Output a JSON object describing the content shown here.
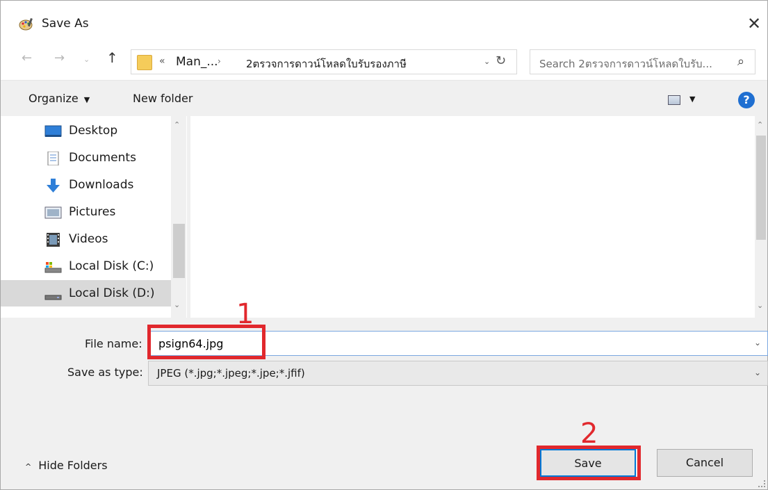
{
  "window": {
    "title": "Save As",
    "close_glyph": "✕",
    "icons": {
      "app": "palette-app-icon",
      "close": "close-icon"
    }
  },
  "nav": {
    "back": "←",
    "forward": "→",
    "recent": "⌄",
    "up": "↑",
    "breadcrumb_overflow": "«",
    "breadcrumbs": [
      "Man_...",
      "2ตรวจการดาวน์โหลดใบรับรองภาษี"
    ],
    "breadcrumb_sep": "›",
    "dropdown_glyph": "⌄",
    "refresh_glyph": "↻",
    "search_placeholder": "Search 2ตรวจการดาวน์โหลดใบรับ...",
    "search_glyph": "⌕"
  },
  "toolbar": {
    "organize_label": "Organize",
    "organize_arrow": "▼",
    "new_folder_label": "New folder",
    "view_arrow": "▼",
    "help_glyph": "?"
  },
  "sidebar": {
    "items": [
      {
        "label": "Desktop",
        "icon": "desktop-icon"
      },
      {
        "label": "Documents",
        "icon": "documents-icon"
      },
      {
        "label": "Downloads",
        "icon": "downloads-icon"
      },
      {
        "label": "Pictures",
        "icon": "pictures-icon"
      },
      {
        "label": "Videos",
        "icon": "videos-icon"
      },
      {
        "label": "Local Disk (C:)",
        "icon": "drive-c-icon"
      },
      {
        "label": "Local Disk (D:)",
        "icon": "drive-d-icon",
        "selected": true
      }
    ],
    "scroll_up": "⌃",
    "scroll_down": "⌄"
  },
  "fields": {
    "file_name_label": "File name:",
    "file_name_value": "psign64.jpg",
    "save_as_type_label": "Save as type:",
    "save_as_type_value": "JPEG (*.jpg;*.jpeg;*.jpe;*.jfif)",
    "dropdown_glyph": "⌄"
  },
  "annotations": {
    "step1": "1",
    "step2": "2",
    "color": "#e1282d"
  },
  "footer": {
    "hide_folders_label": "Hide Folders",
    "hide_folders_chevron": "^",
    "save_label": "Save",
    "cancel_label": "Cancel"
  },
  "colors": {
    "accent": "#0078d7",
    "help": "#1f6fd1",
    "folder": "#f5cc5a"
  }
}
